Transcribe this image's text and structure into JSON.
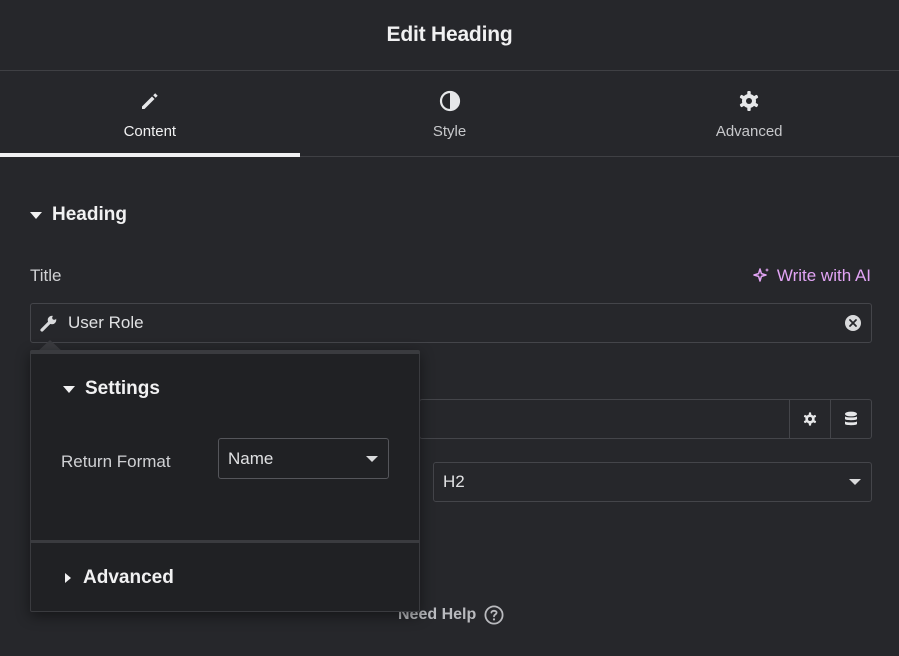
{
  "header": {
    "title": "Edit Heading"
  },
  "tabs": [
    {
      "label": "Content",
      "icon": "pencil-icon",
      "active": true
    },
    {
      "label": "Style",
      "icon": "contrast-icon",
      "active": false
    },
    {
      "label": "Advanced",
      "icon": "gear-icon",
      "active": false
    }
  ],
  "section": {
    "heading": "Heading"
  },
  "title_field": {
    "label": "Title",
    "ai_link": "Write with AI",
    "value": "User Role"
  },
  "size_select": {
    "value": "H2"
  },
  "popover": {
    "settings_label": "Settings",
    "return_format_label": "Return Format",
    "return_format_value": "Name",
    "advanced_label": "Advanced"
  },
  "footer": {
    "need_help": "Need Help"
  },
  "colors": {
    "background": "#26272b",
    "accent_ai": "#e2a4f5",
    "text": "#e0e1e3"
  }
}
